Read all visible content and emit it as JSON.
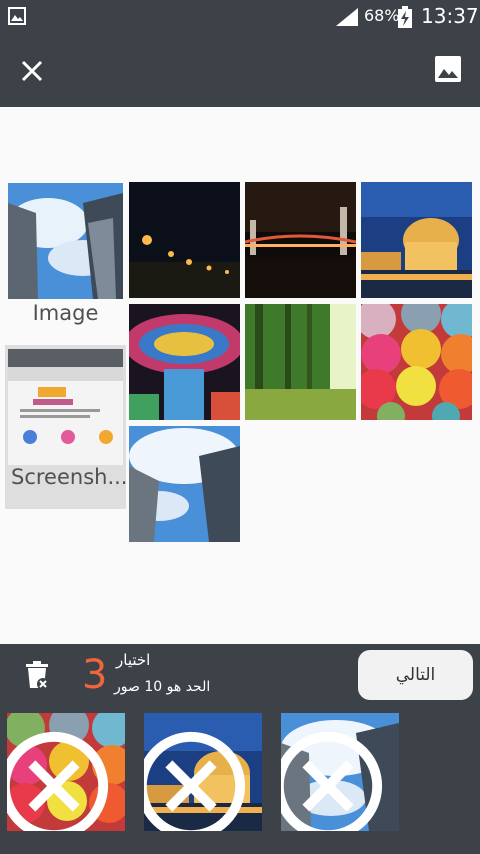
{
  "status_bar": {
    "battery_percent": "68%",
    "time": "13:37"
  },
  "toolbar": {
    "close_icon": "close-icon",
    "gallery_icon": "image-icon"
  },
  "folders": [
    {
      "label": "Image",
      "selected": false
    },
    {
      "label": "Screensh...",
      "selected": true
    }
  ],
  "photos": [
    {
      "name": "night-street-lights"
    },
    {
      "name": "night-bridge"
    },
    {
      "name": "palace-of-fine-arts"
    },
    {
      "name": "colorful-light-tower"
    },
    {
      "name": "forest-sunlight"
    },
    {
      "name": "colorful-yarn"
    },
    {
      "name": "skyscrapers-sky"
    }
  ],
  "selection": {
    "count": "3",
    "label": "اختيار",
    "limit": "الحد هو 10 صور",
    "next_label": "التالي"
  },
  "selected_items": [
    {
      "name": "colorful-yarn"
    },
    {
      "name": "palace-of-fine-arts"
    },
    {
      "name": "skyscrapers-sky"
    }
  ],
  "colors": {
    "bar": "#3d4249",
    "accent": "#f0663a"
  }
}
